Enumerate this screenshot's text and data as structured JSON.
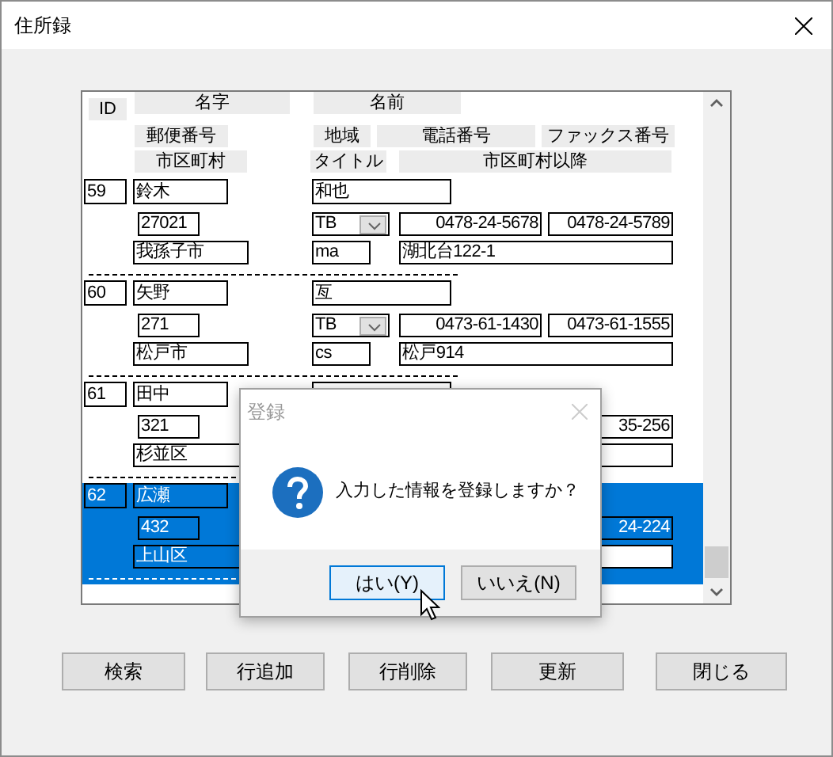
{
  "window": {
    "title": "住所録"
  },
  "headers": [
    {
      "kind": "id",
      "label": "ID"
    },
    {
      "kind": "surname",
      "label": "名字"
    },
    {
      "kind": "given",
      "label": "名前"
    },
    {
      "kind": "zip",
      "label": "郵便番号"
    },
    {
      "kind": "region",
      "label": "地域"
    },
    {
      "kind": "phone",
      "label": "電話番号"
    },
    {
      "kind": "fax",
      "label": "ファックス番号"
    },
    {
      "kind": "city",
      "label": "市区町村"
    },
    {
      "kind": "title",
      "label": "タイトル"
    },
    {
      "kind": "address",
      "label": "市区町村以降"
    }
  ],
  "records": [
    {
      "selected": false,
      "fields": [
        {
          "kind": "id",
          "value": "59"
        },
        {
          "kind": "surname",
          "value": "鈴木"
        },
        {
          "kind": "given",
          "value": "和也"
        },
        {
          "kind": "zip",
          "value": "27021"
        },
        {
          "kind": "region",
          "value": "TB"
        },
        {
          "kind": "phone",
          "value": "0478-24-5678"
        },
        {
          "kind": "fax",
          "value": "0478-24-5789"
        },
        {
          "kind": "city",
          "value": "我孫子市"
        },
        {
          "kind": "title",
          "value": "ma"
        },
        {
          "kind": "address",
          "value": "湖北台122-1"
        }
      ]
    },
    {
      "selected": false,
      "fields": [
        {
          "kind": "id",
          "value": "60"
        },
        {
          "kind": "surname",
          "value": "矢野"
        },
        {
          "kind": "given",
          "value": "亙"
        },
        {
          "kind": "zip",
          "value": "271"
        },
        {
          "kind": "region",
          "value": "TB"
        },
        {
          "kind": "phone",
          "value": "0473-61-1430"
        },
        {
          "kind": "fax",
          "value": "0473-61-1555"
        },
        {
          "kind": "city",
          "value": "松戸市"
        },
        {
          "kind": "title",
          "value": "cs"
        },
        {
          "kind": "address",
          "value": "松戸914"
        }
      ]
    },
    {
      "selected": false,
      "fields": [
        {
          "kind": "id",
          "value": "61"
        },
        {
          "kind": "surname",
          "value": "田中"
        },
        {
          "kind": "given"
        },
        {
          "kind": "zip",
          "value": "321"
        },
        {
          "kind": "fax",
          "value": "35-256"
        },
        {
          "kind": "city",
          "value": "杉並区"
        },
        {
          "kind": "address"
        }
      ]
    },
    {
      "selected": true,
      "fields": [
        {
          "kind": "id",
          "value": "62"
        },
        {
          "kind": "surname",
          "value": "広瀬"
        },
        {
          "kind": "zip",
          "value": "432"
        },
        {
          "kind": "fax",
          "value": "24-224"
        },
        {
          "kind": "city",
          "value": "上山区"
        },
        {
          "kind": "address"
        }
      ]
    }
  ],
  "dialog": {
    "title": "登録",
    "message": "入力した情報を登録しますか？",
    "buttons": [
      {
        "label": "はい(Y)",
        "default": true
      },
      {
        "label": "いいえ(N)",
        "default": false
      }
    ]
  },
  "buttons": [
    "検索",
    "行追加",
    "行削除",
    "更新",
    "閉じる"
  ]
}
